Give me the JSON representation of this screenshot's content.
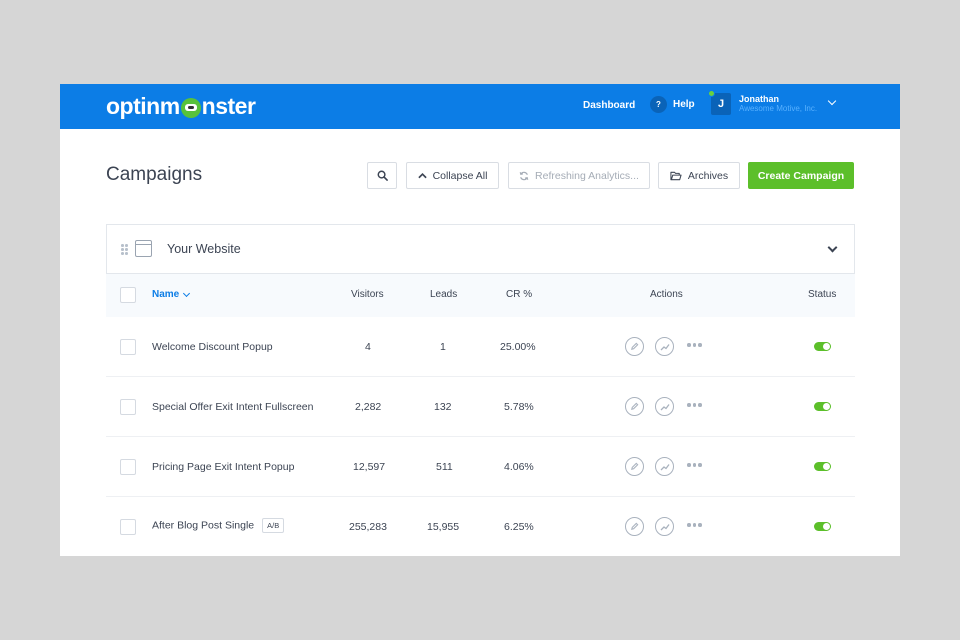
{
  "header": {
    "logo_text_left": "optinm",
    "logo_text_right": "nster",
    "nav_dashboard": "Dashboard",
    "help_icon": "?",
    "nav_help": "Help",
    "user_initial": "J",
    "user_name": "Jonathan",
    "user_org": "Awesome Motive, Inc."
  },
  "page": {
    "title": "Campaigns"
  },
  "toolbar": {
    "collapse_label": "Collapse All",
    "refresh_label": "Refreshing Analytics...",
    "archives_label": "Archives",
    "create_label": "Create Campaign"
  },
  "site": {
    "name": "Your Website"
  },
  "table": {
    "headers": {
      "name": "Name",
      "visitors": "Visitors",
      "leads": "Leads",
      "cr": "CR %",
      "actions": "Actions",
      "status": "Status"
    },
    "rows": [
      {
        "name": "Welcome Discount Popup",
        "badge": "",
        "visitors": "4",
        "leads": "1",
        "cr": "25.00%",
        "status_on": true
      },
      {
        "name": "Special Offer Exit Intent Fullscreen",
        "badge": "",
        "visitors": "2,282",
        "leads": "132",
        "cr": "5.78%",
        "status_on": true
      },
      {
        "name": "Pricing Page Exit Intent Popup",
        "badge": "",
        "visitors": "12,597",
        "leads": "511",
        "cr": "4.06%",
        "status_on": true
      },
      {
        "name": "After Blog Post Single",
        "badge": "A/B",
        "visitors": "255,283",
        "leads": "15,955",
        "cr": "6.25%",
        "status_on": true
      }
    ]
  },
  "colors": {
    "brand_blue": "#0c7de6",
    "create_green": "#5cbf2a",
    "status_green": "#5cbf2a"
  },
  "icons": {
    "search": "search-icon",
    "collapse": "chevron-up-icon",
    "refresh": "refresh-icon",
    "archives": "folder-icon",
    "edit": "pencil-icon",
    "analytics": "trend-icon",
    "more": "more-dots-icon"
  }
}
